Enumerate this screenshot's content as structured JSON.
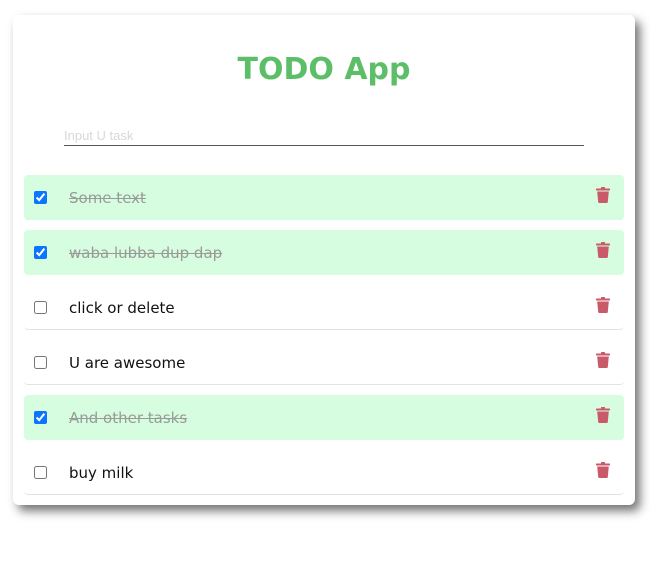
{
  "app": {
    "title": "TODO App",
    "accent_color": "#5cbf68",
    "done_bg_color": "#d6fddf",
    "trash_color": "#c85a6a"
  },
  "input": {
    "placeholder": "Input U task",
    "value": ""
  },
  "tasks": [
    {
      "text": "Some text",
      "done": true,
      "icon": "trash-icon"
    },
    {
      "text": "waba lubba dup dap",
      "done": true,
      "icon": "trash-icon"
    },
    {
      "text": "click or delete",
      "done": false,
      "icon": "trash-icon"
    },
    {
      "text": "U are awesome",
      "done": false,
      "icon": "trash-icon"
    },
    {
      "text": "And other tasks",
      "done": true,
      "icon": "trash-icon"
    },
    {
      "text": "buy milk",
      "done": false,
      "icon": "trash-icon"
    }
  ]
}
